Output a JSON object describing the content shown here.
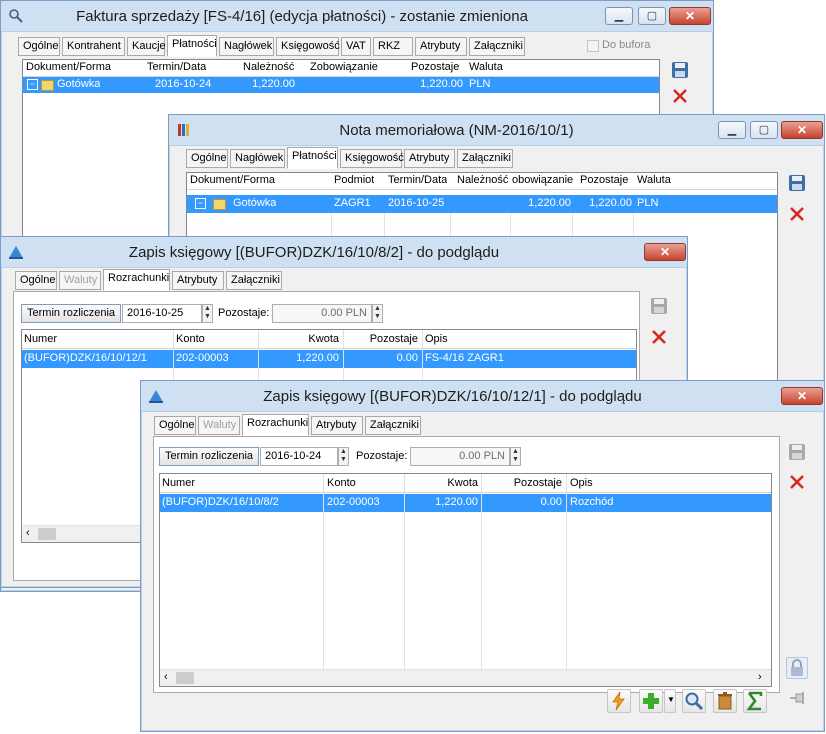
{
  "w1": {
    "title": "Faktura sprzedaży [FS-4/16] (edycja płatności) - zostanie zmieniona",
    "tabs": [
      "Ogólne",
      "Kontrahent",
      "Kaucje",
      "Płatności",
      "Nagłówek",
      "Księgowość",
      "VAT",
      "RKZ",
      "Atrybuty",
      "Załączniki"
    ],
    "buffer_label": "Do bufora",
    "columns": [
      "Dokument/Forma",
      "Termin/Data",
      "Należność",
      "Zobowiązanie",
      "Pozostaje",
      "Waluta"
    ],
    "row": {
      "forma": "Gotówka",
      "termin": "2016-10-24",
      "naleznosc": "1,220.00",
      "zobowiazanie": "",
      "pozostaje": "1,220.00",
      "waluta": "PLN"
    }
  },
  "w2": {
    "title": "Nota memoriałowa (NM-2016/10/1)",
    "tabs": [
      "Ogólne",
      "Nagłówek",
      "Płatności",
      "Księgowość",
      "Atrybuty",
      "Załączniki"
    ],
    "columns": [
      "Dokument/Forma",
      "Podmiot",
      "Termin/Data",
      "Należność",
      "obowiązanie",
      "Pozostaje",
      "Waluta"
    ],
    "row": {
      "forma": "Gotówka",
      "podmiot": "ZAGR1",
      "termin": "2016-10-25",
      "naleznosc": "",
      "zobowiazanie": "1,220.00",
      "pozostaje": "1,220.00",
      "waluta": "PLN"
    }
  },
  "w3": {
    "title": "Zapis księgowy [(BUFOR)DZK/16/10/8/2] - do podglądu",
    "tabs": [
      "Ogólne",
      "Waluty",
      "Rozrachunki",
      "Atrybuty",
      "Załączniki"
    ],
    "termin_button": "Termin rozliczenia",
    "date": "2016-10-25",
    "pozostaje_label": "Pozostaje:",
    "pozostaje_value": "0.00 PLN",
    "columns": [
      "Numer",
      "Konto",
      "Kwota",
      "Pozostaje",
      "Opis"
    ],
    "row": {
      "numer": "(BUFOR)DZK/16/10/12/1",
      "konto": "202-00003",
      "kwota": "1,220.00",
      "pozostaje": "0.00",
      "opis": "FS-4/16 ZAGR1"
    }
  },
  "w4": {
    "title": "Zapis księgowy [(BUFOR)DZK/16/10/12/1] - do podglądu",
    "tabs": [
      "Ogólne",
      "Waluty",
      "Rozrachunki",
      "Atrybuty",
      "Załączniki"
    ],
    "termin_button": "Termin rozliczenia",
    "date": "2016-10-24",
    "pozostaje_label": "Pozostaje:",
    "pozostaje_value": "0.00 PLN",
    "columns": [
      "Numer",
      "Konto",
      "Kwota",
      "Pozostaje",
      "Opis"
    ],
    "row": {
      "numer": "(BUFOR)DZK/16/10/8/2",
      "konto": "202-00003",
      "kwota": "1,220.00",
      "pozostaje": "0.00",
      "opis": "Rozchód"
    }
  },
  "colors": {
    "selection": "#3399ff",
    "titlebar": "#cfe0f3",
    "close": "#c7442e"
  }
}
